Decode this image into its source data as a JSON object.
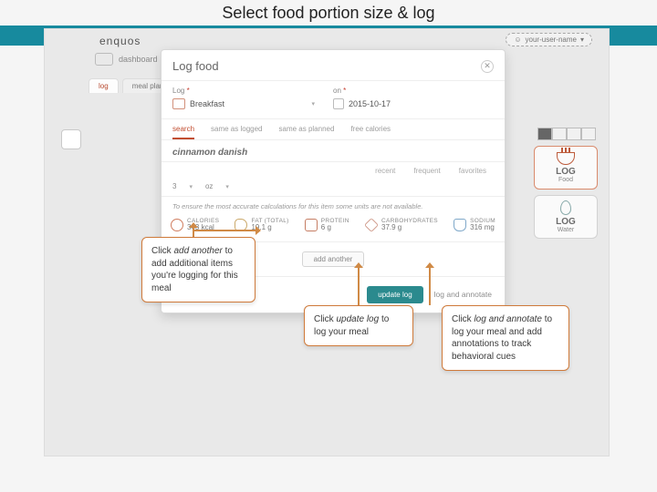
{
  "slide": {
    "title": "Select food portion size & log"
  },
  "header": {
    "brand": "enquos",
    "user_pill": "your-user-name",
    "dashboard_label": "dashboard"
  },
  "tabs": {
    "items": [
      "log",
      "meal plan"
    ]
  },
  "right_panel": {
    "log_food": "LOG",
    "log_food_sub": "Food",
    "log_water": "LOG",
    "log_water_sub": "Water"
  },
  "modal": {
    "title": "Log food",
    "field_log_label": "Log",
    "field_on_label": "on",
    "asterisk": "*",
    "meal_value": "Breakfast",
    "date_value": "2015-10-17",
    "subtabs": [
      "search",
      "same as logged",
      "same as planned",
      "free calories"
    ],
    "food_name": "cinnamon danish",
    "filters": [
      "recent",
      "frequent",
      "favorites"
    ],
    "portion_qty": "3",
    "portion_unit": "oz",
    "note": "To ensure the most accurate calculations for this item some units are not available.",
    "nutrition": {
      "calories_label": "CALORIES",
      "calories_value": "343 kcal",
      "fat_label": "FAT (TOTAL)",
      "fat_value": "19.1 g",
      "protein_label": "PROTEIN",
      "protein_value": "6 g",
      "carbs_label": "CARBOHYDRATES",
      "carbs_value": "37.9 g",
      "sodium_label": "SODIUM",
      "sodium_value": "316 mg"
    },
    "add_another_label": "add another",
    "update_label": "update log",
    "annotate_label": "log and annotate"
  },
  "callouts": {
    "c1_line1": "Click ",
    "c1_em": "add another",
    "c1_rest": " to add additional items you're logging for this meal",
    "c2_line1": "Click ",
    "c2_em": "update log",
    "c2_rest": " to log your meal",
    "c3_line1": "Click ",
    "c3_em": "log and annotate",
    "c3_rest": " to log your meal and add annotations to track behavioral cues"
  }
}
